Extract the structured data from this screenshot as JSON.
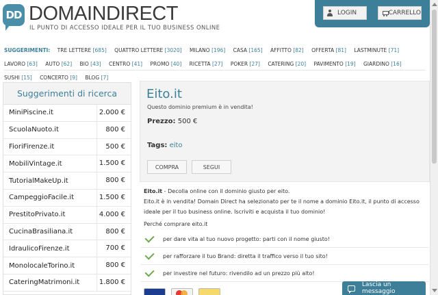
{
  "header": {
    "logo_badge": "DD",
    "logo_name": "DOMAINDIRECT",
    "tagline": "IL PUNTO DI ACCESSO IDEALE PER IL TUO BUSINESS ONLINE",
    "login_label": "LOGIN",
    "cart_label": "CARRELLO"
  },
  "suggestions": {
    "label": "SUGGERIMENTI:",
    "tags": [
      {
        "name": "TRE LETTERE",
        "count": "[685]"
      },
      {
        "name": "QUATTRO LETTERE",
        "count": "[3020]"
      },
      {
        "name": "MILANO",
        "count": "[196]"
      },
      {
        "name": "CASA",
        "count": "[165]"
      },
      {
        "name": "AFFITTO",
        "count": "[82]"
      },
      {
        "name": "OFFERTA",
        "count": "[81]"
      },
      {
        "name": "LASTMINUTE",
        "count": "[71]"
      },
      {
        "name": "LAVORO",
        "count": "[63]"
      },
      {
        "name": "AUTO",
        "count": "[62]"
      },
      {
        "name": "BIO",
        "count": "[43]"
      },
      {
        "name": "CENTRO",
        "count": "[41]"
      },
      {
        "name": "PROMO",
        "count": "[40]"
      },
      {
        "name": "RICETTA",
        "count": "[27]"
      },
      {
        "name": "POKER",
        "count": "[27]"
      },
      {
        "name": "CATERING",
        "count": "[20]"
      },
      {
        "name": "PAVIMENTO",
        "count": "[19]"
      },
      {
        "name": "GIARDINO",
        "count": "[16]"
      },
      {
        "name": "SUSHI",
        "count": "[15]"
      },
      {
        "name": "CONCERTO",
        "count": "[9]"
      },
      {
        "name": "BLOG",
        "count": "[7]"
      }
    ]
  },
  "sidebar": {
    "title": "Suggerimenti di ricerca",
    "items": [
      {
        "name": "MiniPiscine.it",
        "price": "2.000 €"
      },
      {
        "name": "ScuolaNuoto.it",
        "price": "800 €"
      },
      {
        "name": "FioriFirenze.it",
        "price": "500 €"
      },
      {
        "name": "MobiliVintage.it",
        "price": "1.500 €"
      },
      {
        "name": "TutorialMakeUp.it",
        "price": "800 €"
      },
      {
        "name": "CampeggioFacile.it",
        "price": "1.500 €"
      },
      {
        "name": "PrestitoPrivato.it",
        "price": "4.000 €"
      },
      {
        "name": "CucinaBrasiliana.it",
        "price": "800 €"
      },
      {
        "name": "IdraulicoFirenze.it",
        "price": "700 €"
      },
      {
        "name": "MonolocaleTorino.it",
        "price": "800 €"
      },
      {
        "name": "CateringMatrimoni.it",
        "price": "1.800 €"
      }
    ]
  },
  "domain": {
    "name": "Eito.it",
    "subtitle": "Questo dominio premium è in vendita!",
    "price_label": "Prezzo:",
    "price_value": "500 €",
    "tags_label": "Tags:",
    "tag": "eito",
    "buy_label": "COMPRA",
    "follow_label": "SEGUI"
  },
  "description": {
    "lead_bold": "Eito.it",
    "lead_rest": " - Decolla online con il dominio giusto per eito.",
    "body": "Eito.it è in vendita! Domain Direct ha selezionato per te il nome a dominio Eito.it, il punto di accesso ideale per il tuo business online. Iscriviti e acquista il tuo dominio!",
    "why_title": "Perché comprare eito.it",
    "bullets": [
      "per dare vita al tuo nuovo progetto: parti con il nome giusto!",
      "per rafforzare il tuo Brand: diretta il traffico verso il tuo sito!",
      "per investire nel futuro: rivendilo ad un prezzo più alto!"
    ]
  },
  "chat": {
    "label": "Lascia un messaggio"
  }
}
